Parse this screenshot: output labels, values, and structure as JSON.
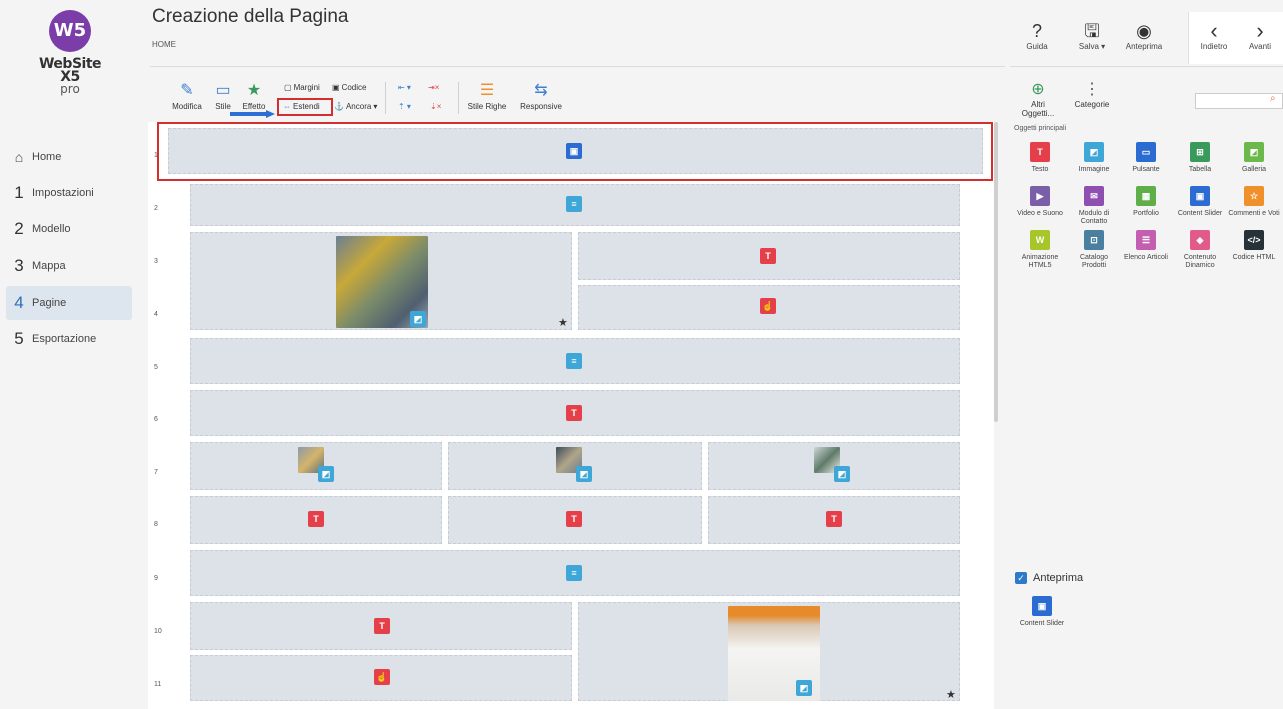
{
  "app": {
    "logo_mark": "W5",
    "logo_name": "WebSite X5",
    "logo_sub": "pro",
    "title": "Creazione della Pagina",
    "breadcrumb": "HOME"
  },
  "sidebar": {
    "items": [
      {
        "num": "",
        "label": "Home",
        "icon": "home-icon"
      },
      {
        "num": "1",
        "label": "Impostazioni"
      },
      {
        "num": "2",
        "label": "Modello"
      },
      {
        "num": "3",
        "label": "Mappa"
      },
      {
        "num": "4",
        "label": "Pagine",
        "active": true
      },
      {
        "num": "5",
        "label": "Esportazione"
      }
    ]
  },
  "top_actions": {
    "help": "Guida",
    "save": "Salva ▾",
    "preview": "Anteprima",
    "back": "Indietro",
    "forward": "Avanti"
  },
  "toolbar": {
    "modifica": "Modifica",
    "stile": "Stile",
    "effetto": "Effetto",
    "margini": "Margini",
    "codice": "Codice",
    "estendi": "Estendi",
    "ancora": "Ancora",
    "stile_righe": "Stile Righe",
    "responsive": "Responsive"
  },
  "row_numbers": [
    "1",
    "2",
    "3",
    "4",
    "5",
    "6",
    "7",
    "8",
    "9",
    "10",
    "11"
  ],
  "right_panel": {
    "altri_oggetti": "Altri Oggetti...",
    "categorie": "Categorie",
    "section_title": "Oggetti principali",
    "objects": [
      {
        "label": "Testo",
        "color": "#e5404a",
        "icon": "text-icon"
      },
      {
        "label": "Immagine",
        "color": "#3fa7d8",
        "icon": "image-icon"
      },
      {
        "label": "Pulsante",
        "color": "#2c6bd1",
        "icon": "button-icon"
      },
      {
        "label": "Tabella",
        "color": "#3a9a5c",
        "icon": "table-icon"
      },
      {
        "label": "Galleria",
        "color": "#6cb84a",
        "icon": "gallery-icon"
      },
      {
        "label": "Video e Suono",
        "color": "#7b5ea8",
        "icon": "video-icon"
      },
      {
        "label": "Modulo di Contatto",
        "color": "#8e4fb0",
        "icon": "contact-form-icon"
      },
      {
        "label": "Portfolio",
        "color": "#5fae4a",
        "icon": "portfolio-icon"
      },
      {
        "label": "Content Slider",
        "color": "#2c6bd1",
        "icon": "content-slider-icon"
      },
      {
        "label": "Commenti e Voti",
        "color": "#f0902a",
        "icon": "comments-icon"
      },
      {
        "label": "Animazione HTML5",
        "color": "#a8c52a",
        "icon": "animation-icon"
      },
      {
        "label": "Catalogo Prodotti",
        "color": "#4a7fa0",
        "icon": "catalog-icon"
      },
      {
        "label": "Elenco Articoli",
        "color": "#c45fb0",
        "icon": "articles-icon"
      },
      {
        "label": "Contenuto Dinamico",
        "color": "#e05a8a",
        "icon": "dynamic-content-icon"
      },
      {
        "label": "Codice HTML",
        "color": "#263238",
        "icon": "html-code-icon"
      }
    ],
    "preview_label": "Anteprima",
    "preview_object": "Content Slider"
  }
}
